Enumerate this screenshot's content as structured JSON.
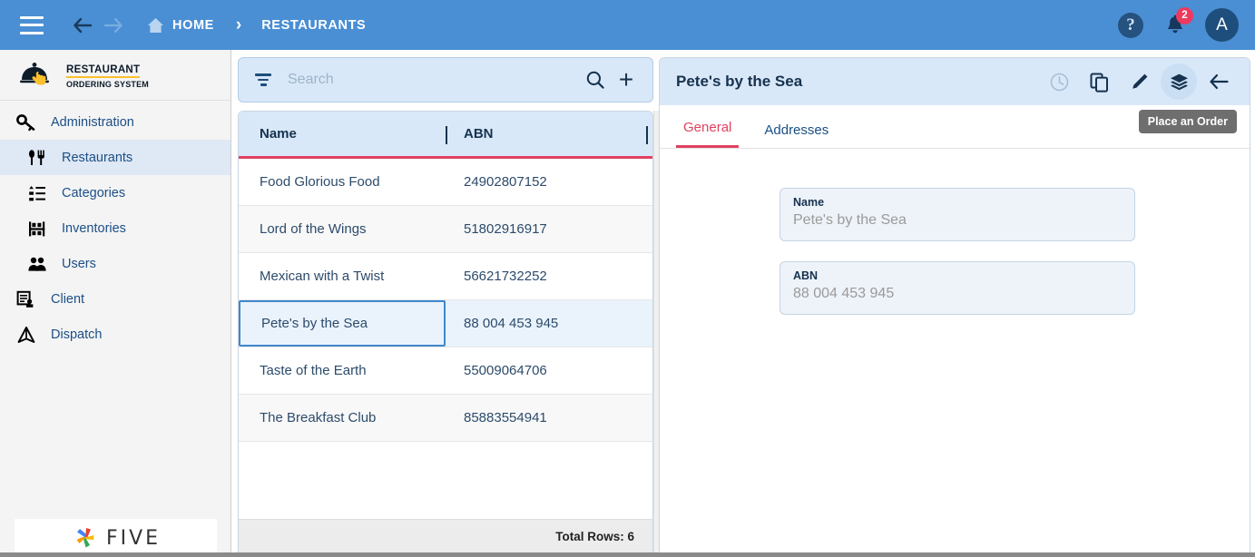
{
  "topbar": {
    "menu_icon": "hamburger-icon",
    "back_icon": "arrow-left-icon",
    "forward_icon": "arrow-right-icon",
    "home_label": "HOME",
    "separator": "›",
    "current_label": "RESTAURANTS",
    "help_label": "?",
    "notification_count": "2",
    "avatar_initial": "A",
    "bg_color": "#4a8fd4"
  },
  "sidebar": {
    "logo": {
      "line1": "RESTAURANT",
      "line2": "ORDERING SYSTEM"
    },
    "items": [
      {
        "label": "Administration",
        "icon": "key-icon",
        "level": 0,
        "active": false
      },
      {
        "label": "Restaurants",
        "icon": "cutlery-icon",
        "level": 1,
        "active": true
      },
      {
        "label": "Categories",
        "icon": "list-icon",
        "level": 1,
        "active": false
      },
      {
        "label": "Inventories",
        "icon": "shelf-icon",
        "level": 1,
        "active": false
      },
      {
        "label": "Users",
        "icon": "users-icon",
        "level": 1,
        "active": false
      },
      {
        "label": "Client",
        "icon": "client-form-icon",
        "level": 0,
        "active": false
      },
      {
        "label": "Dispatch",
        "icon": "dispatch-icon",
        "level": 0,
        "active": false
      }
    ],
    "footer_brand": "FIVE"
  },
  "list_panel": {
    "search": {
      "placeholder": "Search",
      "value": "",
      "filter_icon": "filter-icon",
      "search_icon": "search-icon",
      "add_icon": "plus-icon"
    },
    "columns": [
      "Name",
      "ABN"
    ],
    "rows": [
      {
        "name": "Food Glorious Food",
        "abn": "24902807152",
        "selected": false
      },
      {
        "name": "Lord of the Wings",
        "abn": "51802916917",
        "selected": false
      },
      {
        "name": "Mexican with a Twist",
        "abn": "56621732252",
        "selected": false
      },
      {
        "name": "Pete's by the Sea",
        "abn": "88 004 453 945",
        "selected": true
      },
      {
        "name": "Taste of the Earth",
        "abn": "55009064706",
        "selected": false
      },
      {
        "name": "The Breakfast Club",
        "abn": "85883554941",
        "selected": false
      }
    ],
    "footer_total": "Total Rows: 6",
    "header_accent_color": "#e1415f"
  },
  "detail_panel": {
    "title": "Pete's by the Sea",
    "toolbar": [
      {
        "name": "history-clock-icon",
        "state": "disabled"
      },
      {
        "name": "copy-icon",
        "state": "normal"
      },
      {
        "name": "edit-pencil-icon",
        "state": "normal"
      },
      {
        "name": "layers-icon",
        "state": "active"
      },
      {
        "name": "arrow-left-icon",
        "state": "normal"
      }
    ],
    "tabs": [
      {
        "label": "General",
        "active": true
      },
      {
        "label": "Addresses",
        "active": false
      }
    ],
    "tooltip": "Place an Order",
    "fields": [
      {
        "label": "Name",
        "value": "Pete's by the Sea"
      },
      {
        "label": "ABN",
        "value": "88 004 453 945"
      }
    ],
    "accent_color": "#e1415f"
  }
}
